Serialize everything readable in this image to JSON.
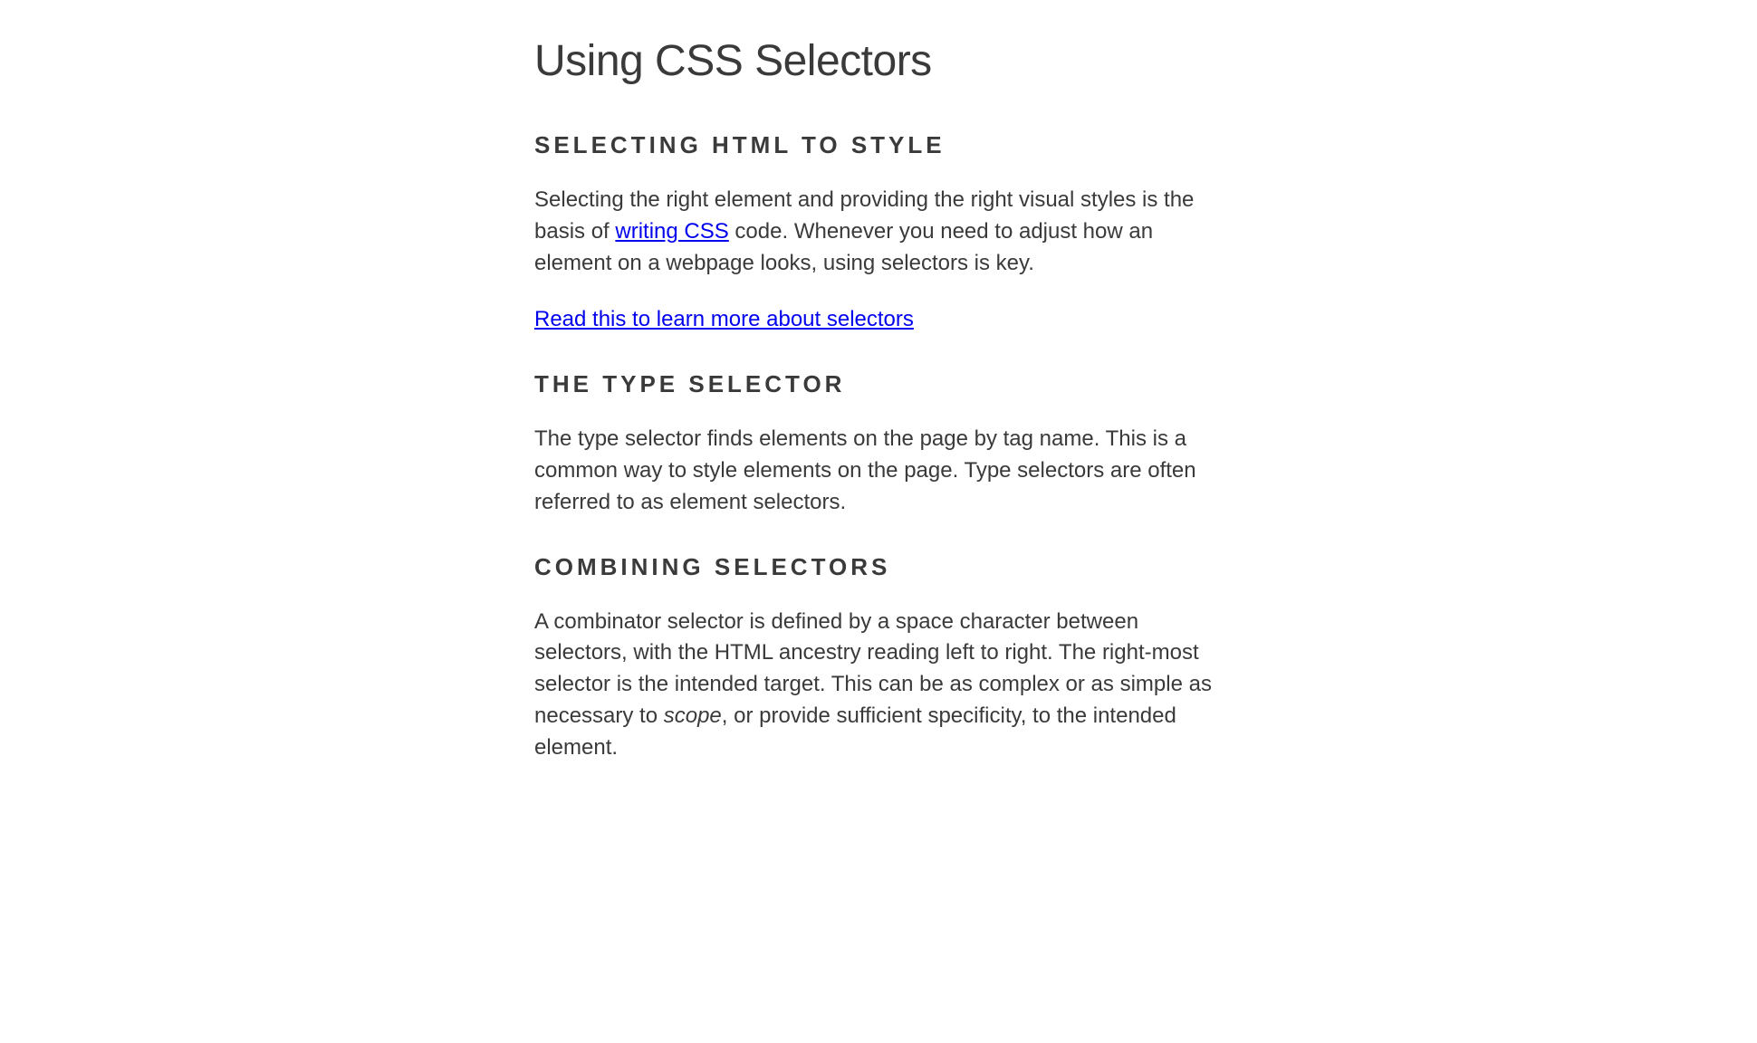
{
  "title": "Using CSS Selectors",
  "sections": [
    {
      "heading": "SELECTING HTML TO STYLE",
      "paragraph_before_link": "Selecting the right element and providing the right visual styles is the basis of ",
      "inline_link_text": "writing CSS",
      "paragraph_after_link": " code. Whenever you need to adjust how an element on a webpage looks, using selectors is key.",
      "standalone_link": "Read this to learn more about selectors"
    },
    {
      "heading": "THE TYPE SELECTOR",
      "paragraph": "The type selector finds elements on the page by tag name. This is a common way to style elements on the page. Type selectors are often referred to as element selectors."
    },
    {
      "heading": "COMBINING SELECTORS",
      "paragraph_before_em": "A combinator selector is defined by a space character between selectors, with the HTML ancestry reading left to right. The right-most selector is the intended target. This can be as complex or as simple as necessary to ",
      "em_text": "scope",
      "paragraph_after_em": ", or provide sufficient specificity, to the intended element."
    }
  ]
}
